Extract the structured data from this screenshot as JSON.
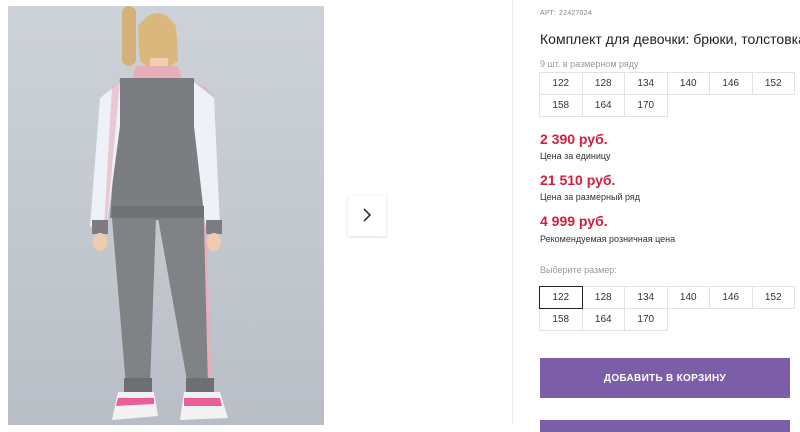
{
  "product": {
    "art_label": "АРТ:",
    "art_number": "22427024",
    "title": "Комплект для девочки: брюки, толстовка"
  },
  "row_sizes": {
    "note": "9 шт. в размерном ряду",
    "sizes": [
      "122",
      "128",
      "134",
      "140",
      "146",
      "152",
      "158",
      "164",
      "170"
    ]
  },
  "prices": [
    {
      "value": "2 390 руб.",
      "note": "Цена за единицу"
    },
    {
      "value": "21 510 руб.",
      "note": "Цена за размерный ряд"
    },
    {
      "value": "4 999 руб.",
      "note": "Рекомендуемая розничная цена"
    }
  ],
  "size_picker": {
    "label": "Выберите размер:",
    "sizes": [
      "122",
      "128",
      "134",
      "140",
      "146",
      "152",
      "158",
      "164",
      "170"
    ],
    "selected": "122"
  },
  "buttons": {
    "add_to_cart": "ДОБАВИТЬ В КОРЗИНУ"
  },
  "colors": {
    "price": "#d21f3c",
    "accent": "#7b5ea7"
  },
  "icons": {
    "next": "chevron-right-icon"
  }
}
